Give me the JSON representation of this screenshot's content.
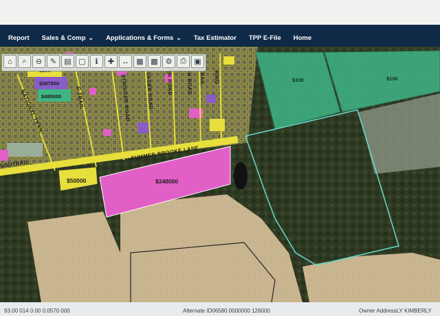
{
  "nav": {
    "items": [
      {
        "label": "Report",
        "dropdown": false
      },
      {
        "label": "Sales & Comp",
        "dropdown": true
      },
      {
        "label": "Applications & Forms",
        "dropdown": true
      },
      {
        "label": "Tax Estimator",
        "dropdown": false
      },
      {
        "label": "TPP E-File",
        "dropdown": false
      },
      {
        "label": "Home",
        "dropdown": false
      }
    ]
  },
  "toolbar": {
    "tools": [
      "home-icon",
      "zoom-in-icon",
      "zoom-out-icon",
      "pencil-icon",
      "layers-icon",
      "select-icon",
      "identify-icon",
      "pan-icon",
      "measure-icon",
      "map-icon",
      "grid-icon",
      "gear-icon",
      "print-icon",
      "save-icon"
    ]
  },
  "map": {
    "parcel_values": {
      "p100_top_left": "$100",
      "p387500": "$387500",
      "p485000": "$485000",
      "p50000": "$50000",
      "p348000": "$348000",
      "p100_top_right_a": "$100",
      "p100_top_right_b": "$100"
    },
    "roads": {
      "summer_brooke": "SUMMER BROOKE LANE",
      "south_trail": "SOUTRAIL",
      "national_trail": "NATIONAL TRAIL",
      "g_trail": "G TRAIL",
      "stringer_road": "STRINGER ROAD",
      "vager_road": "VAGER ROAD",
      "eer_road": "EER ROAD",
      "ion_road": "ION ROAD",
      "trail": "TRAIL",
      "ring": "RING"
    },
    "colors": {
      "pink": "#e25fc8",
      "yellow": "#e6df3c",
      "purple": "#8a5cc7",
      "green": "#3fb586",
      "teal_outline": "#63d6c9",
      "navbar": "#0f2a47"
    }
  },
  "status": {
    "left": "93.00  014  0.00  0.0570  000",
    "alternate": "Alternate ID06580.0000000 126000",
    "owner": "Owner AddressLY KIMBERLY"
  }
}
